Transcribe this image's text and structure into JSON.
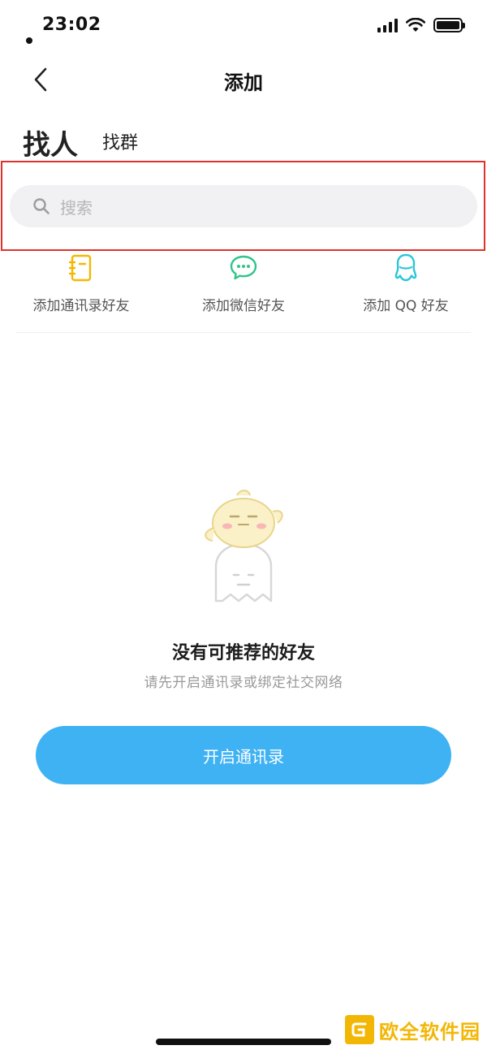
{
  "status_bar": {
    "time": "23:02"
  },
  "nav": {
    "title": "添加"
  },
  "tabs": [
    {
      "label": "找人",
      "active": true
    },
    {
      "label": "找群",
      "active": false
    }
  ],
  "search": {
    "placeholder": "搜索"
  },
  "quick_actions": [
    {
      "label": "添加通讯录好友",
      "icon": "contacts-book-icon",
      "color": "#f5b800"
    },
    {
      "label": "添加微信好友",
      "icon": "wechat-icon",
      "color": "#2fc48a"
    },
    {
      "label": "添加 QQ 好友",
      "icon": "qq-icon",
      "color": "#2ac6d9"
    }
  ],
  "empty_state": {
    "title": "没有可推荐的好友",
    "subtitle": "请先开启通讯录或绑定社交网络"
  },
  "primary_button": {
    "label": "开启通讯录",
    "color": "#3fb2f3"
  },
  "watermark": {
    "text": "欧全软件园"
  },
  "colors": {
    "highlight": "#e0312a",
    "search_bg": "#f1f1f3"
  }
}
